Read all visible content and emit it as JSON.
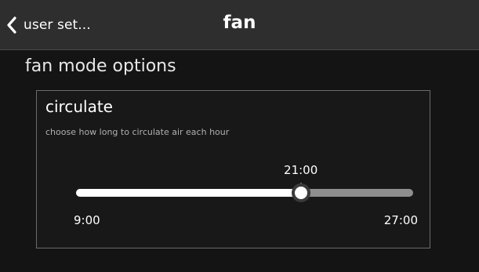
{
  "header": {
    "back_label": "user set...",
    "title": "fan"
  },
  "section": {
    "heading": "fan mode options"
  },
  "circulate": {
    "title": "circulate",
    "description": "choose how long to circulate air each hour",
    "slider": {
      "min_label": "9:00",
      "max_label": "27:00",
      "value_label": "21:00",
      "min": 9,
      "max": 27,
      "value": 21
    }
  },
  "colors": {
    "background": "#141414",
    "header_background": "#2e2e2e",
    "track_filled": "#ffffff",
    "track_empty": "#8e8e8e",
    "panel_border": "#6b6b6b"
  },
  "icons": {
    "back": "chevron-left-icon"
  }
}
